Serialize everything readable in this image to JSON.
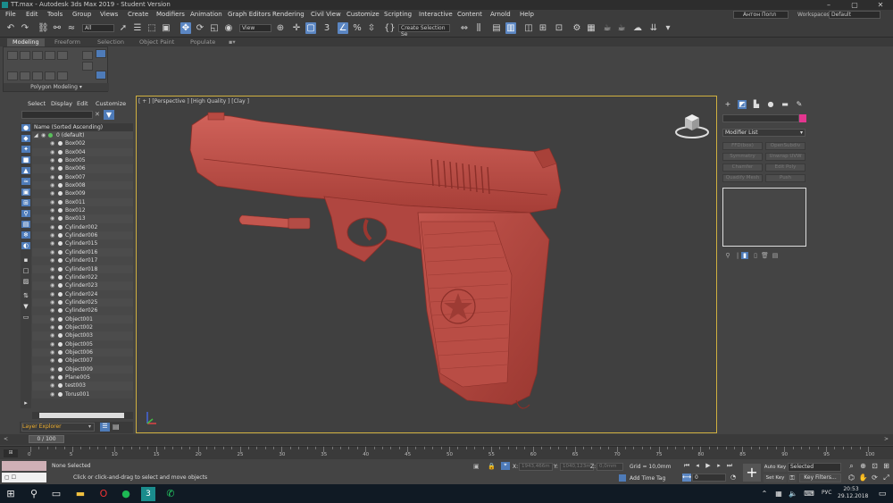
{
  "window": {
    "title": "TT.max - Autodesk 3ds Max 2019 - Student Version",
    "min_glyph": "–",
    "max_glyph": "▢",
    "close_glyph": "✕"
  },
  "menu": [
    "File",
    "Edit",
    "Tools",
    "Group",
    "Views",
    "Create",
    "Modifiers",
    "Animation",
    "Graph Editors",
    "Rendering",
    "Civil View",
    "Customize",
    "Scripting",
    "Interactive",
    "Content",
    "Arnold",
    "Help"
  ],
  "user": {
    "name": "Антон Попл"
  },
  "workspaces": {
    "label": "Workspaces:",
    "value": "Default"
  },
  "toolbar": {
    "filter_value": "All",
    "refcoord_value": "View",
    "selection_set": "Create Selection Se"
  },
  "ribbon": {
    "tabs": [
      "Modeling",
      "Freeform",
      "Selection",
      "Object Paint",
      "Populate"
    ],
    "active_tab": 0,
    "panel_label": "Polygon Modeling ▾"
  },
  "explorer": {
    "menu": [
      "Select",
      "Display",
      "Edit",
      "Customize"
    ],
    "column_header": "Name (Sorted Ascending)",
    "layer_row": "0 (default)",
    "items": [
      "Box002",
      "Box004",
      "Box005",
      "Box006",
      "Box007",
      "Box008",
      "Box009",
      "Box011",
      "Box012",
      "Box013",
      "Cylinder002",
      "Cylinder006",
      "Cylinder015",
      "Cylinder016",
      "Cylinder017",
      "Cylinder018",
      "Cylinder022",
      "Cylinder023",
      "Cylinder024",
      "Cylinder025",
      "Cylinder026",
      "Object001",
      "Object002",
      "Object003",
      "Object005",
      "Object006",
      "Object007",
      "Object009",
      "Plane005",
      "test003",
      "Torus001"
    ],
    "footer_label": "Layer Explorer"
  },
  "viewport": {
    "label": "[ + ] [Perspective ] [High Quality ] [Clay ]",
    "model_color": "#b84a42"
  },
  "command_panel": {
    "modifier_list": "Modifier List",
    "color_swatch": "#e3368f",
    "buttons": [
      "FFD(box)",
      "OpenSubdiv",
      "Symmetry",
      "Unwrap UVW",
      "Chamfer",
      "Edit Poly",
      "Quadify Mesh",
      "Push"
    ]
  },
  "timeline": {
    "frame_label": "0 / 100",
    "ticks": [
      0,
      5,
      10,
      15,
      20,
      25,
      30,
      35,
      40,
      45,
      50,
      55,
      60,
      65,
      70,
      75,
      80,
      85,
      90,
      95,
      100
    ]
  },
  "status": {
    "selection": "None Selected",
    "prompt": "Click or click-and-drag to select and move objects",
    "x_label": "X:",
    "x_value": "1943,466m",
    "y_label": "Y:",
    "y_value": "1040,123m",
    "z_label": "Z:",
    "z_value": "0,0mm",
    "grid": "Grid = 10,0mm",
    "add_time_tag": "Add Time Tag",
    "auto_key": "Auto Key",
    "set_key": "Set Key",
    "selected_dd": "Selected",
    "key_filters": "Key Filters...",
    "frame_value": "0"
  },
  "taskbar": {
    "lang": "РУС",
    "time": "20:53",
    "date": "29.12.2018"
  }
}
